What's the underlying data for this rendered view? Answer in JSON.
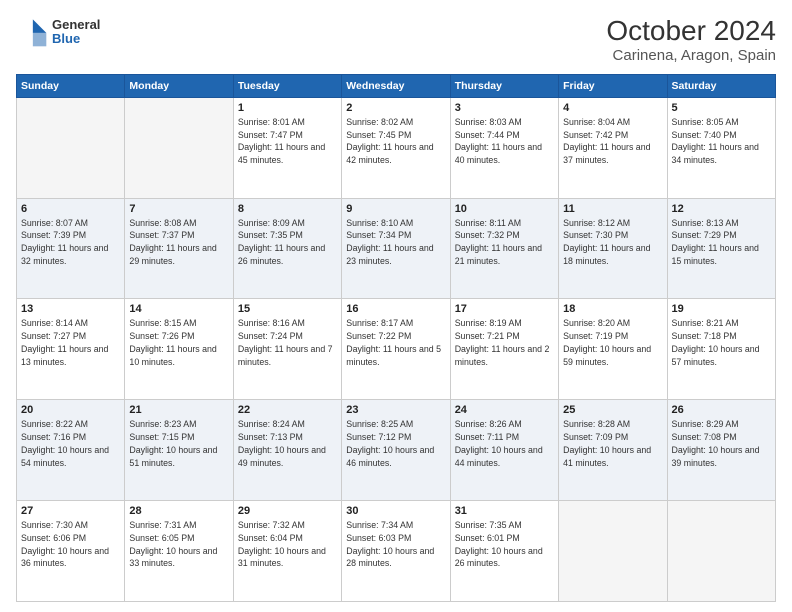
{
  "header": {
    "logo_general": "General",
    "logo_blue": "Blue",
    "title": "October 2024",
    "subtitle": "Carinena, Aragon, Spain"
  },
  "days_of_week": [
    "Sunday",
    "Monday",
    "Tuesday",
    "Wednesday",
    "Thursday",
    "Friday",
    "Saturday"
  ],
  "weeks": [
    [
      {
        "day": "",
        "empty": true
      },
      {
        "day": "",
        "empty": true
      },
      {
        "day": "1",
        "sunrise": "Sunrise: 8:01 AM",
        "sunset": "Sunset: 7:47 PM",
        "daylight": "Daylight: 11 hours and 45 minutes."
      },
      {
        "day": "2",
        "sunrise": "Sunrise: 8:02 AM",
        "sunset": "Sunset: 7:45 PM",
        "daylight": "Daylight: 11 hours and 42 minutes."
      },
      {
        "day": "3",
        "sunrise": "Sunrise: 8:03 AM",
        "sunset": "Sunset: 7:44 PM",
        "daylight": "Daylight: 11 hours and 40 minutes."
      },
      {
        "day": "4",
        "sunrise": "Sunrise: 8:04 AM",
        "sunset": "Sunset: 7:42 PM",
        "daylight": "Daylight: 11 hours and 37 minutes."
      },
      {
        "day": "5",
        "sunrise": "Sunrise: 8:05 AM",
        "sunset": "Sunset: 7:40 PM",
        "daylight": "Daylight: 11 hours and 34 minutes."
      }
    ],
    [
      {
        "day": "6",
        "sunrise": "Sunrise: 8:07 AM",
        "sunset": "Sunset: 7:39 PM",
        "daylight": "Daylight: 11 hours and 32 minutes."
      },
      {
        "day": "7",
        "sunrise": "Sunrise: 8:08 AM",
        "sunset": "Sunset: 7:37 PM",
        "daylight": "Daylight: 11 hours and 29 minutes."
      },
      {
        "day": "8",
        "sunrise": "Sunrise: 8:09 AM",
        "sunset": "Sunset: 7:35 PM",
        "daylight": "Daylight: 11 hours and 26 minutes."
      },
      {
        "day": "9",
        "sunrise": "Sunrise: 8:10 AM",
        "sunset": "Sunset: 7:34 PM",
        "daylight": "Daylight: 11 hours and 23 minutes."
      },
      {
        "day": "10",
        "sunrise": "Sunrise: 8:11 AM",
        "sunset": "Sunset: 7:32 PM",
        "daylight": "Daylight: 11 hours and 21 minutes."
      },
      {
        "day": "11",
        "sunrise": "Sunrise: 8:12 AM",
        "sunset": "Sunset: 7:30 PM",
        "daylight": "Daylight: 11 hours and 18 minutes."
      },
      {
        "day": "12",
        "sunrise": "Sunrise: 8:13 AM",
        "sunset": "Sunset: 7:29 PM",
        "daylight": "Daylight: 11 hours and 15 minutes."
      }
    ],
    [
      {
        "day": "13",
        "sunrise": "Sunrise: 8:14 AM",
        "sunset": "Sunset: 7:27 PM",
        "daylight": "Daylight: 11 hours and 13 minutes."
      },
      {
        "day": "14",
        "sunrise": "Sunrise: 8:15 AM",
        "sunset": "Sunset: 7:26 PM",
        "daylight": "Daylight: 11 hours and 10 minutes."
      },
      {
        "day": "15",
        "sunrise": "Sunrise: 8:16 AM",
        "sunset": "Sunset: 7:24 PM",
        "daylight": "Daylight: 11 hours and 7 minutes."
      },
      {
        "day": "16",
        "sunrise": "Sunrise: 8:17 AM",
        "sunset": "Sunset: 7:22 PM",
        "daylight": "Daylight: 11 hours and 5 minutes."
      },
      {
        "day": "17",
        "sunrise": "Sunrise: 8:19 AM",
        "sunset": "Sunset: 7:21 PM",
        "daylight": "Daylight: 11 hours and 2 minutes."
      },
      {
        "day": "18",
        "sunrise": "Sunrise: 8:20 AM",
        "sunset": "Sunset: 7:19 PM",
        "daylight": "Daylight: 10 hours and 59 minutes."
      },
      {
        "day": "19",
        "sunrise": "Sunrise: 8:21 AM",
        "sunset": "Sunset: 7:18 PM",
        "daylight": "Daylight: 10 hours and 57 minutes."
      }
    ],
    [
      {
        "day": "20",
        "sunrise": "Sunrise: 8:22 AM",
        "sunset": "Sunset: 7:16 PM",
        "daylight": "Daylight: 10 hours and 54 minutes."
      },
      {
        "day": "21",
        "sunrise": "Sunrise: 8:23 AM",
        "sunset": "Sunset: 7:15 PM",
        "daylight": "Daylight: 10 hours and 51 minutes."
      },
      {
        "day": "22",
        "sunrise": "Sunrise: 8:24 AM",
        "sunset": "Sunset: 7:13 PM",
        "daylight": "Daylight: 10 hours and 49 minutes."
      },
      {
        "day": "23",
        "sunrise": "Sunrise: 8:25 AM",
        "sunset": "Sunset: 7:12 PM",
        "daylight": "Daylight: 10 hours and 46 minutes."
      },
      {
        "day": "24",
        "sunrise": "Sunrise: 8:26 AM",
        "sunset": "Sunset: 7:11 PM",
        "daylight": "Daylight: 10 hours and 44 minutes."
      },
      {
        "day": "25",
        "sunrise": "Sunrise: 8:28 AM",
        "sunset": "Sunset: 7:09 PM",
        "daylight": "Daylight: 10 hours and 41 minutes."
      },
      {
        "day": "26",
        "sunrise": "Sunrise: 8:29 AM",
        "sunset": "Sunset: 7:08 PM",
        "daylight": "Daylight: 10 hours and 39 minutes."
      }
    ],
    [
      {
        "day": "27",
        "sunrise": "Sunrise: 7:30 AM",
        "sunset": "Sunset: 6:06 PM",
        "daylight": "Daylight: 10 hours and 36 minutes."
      },
      {
        "day": "28",
        "sunrise": "Sunrise: 7:31 AM",
        "sunset": "Sunset: 6:05 PM",
        "daylight": "Daylight: 10 hours and 33 minutes."
      },
      {
        "day": "29",
        "sunrise": "Sunrise: 7:32 AM",
        "sunset": "Sunset: 6:04 PM",
        "daylight": "Daylight: 10 hours and 31 minutes."
      },
      {
        "day": "30",
        "sunrise": "Sunrise: 7:34 AM",
        "sunset": "Sunset: 6:03 PM",
        "daylight": "Daylight: 10 hours and 28 minutes."
      },
      {
        "day": "31",
        "sunrise": "Sunrise: 7:35 AM",
        "sunset": "Sunset: 6:01 PM",
        "daylight": "Daylight: 10 hours and 26 minutes."
      },
      {
        "day": "",
        "empty": true
      },
      {
        "day": "",
        "empty": true
      }
    ]
  ]
}
